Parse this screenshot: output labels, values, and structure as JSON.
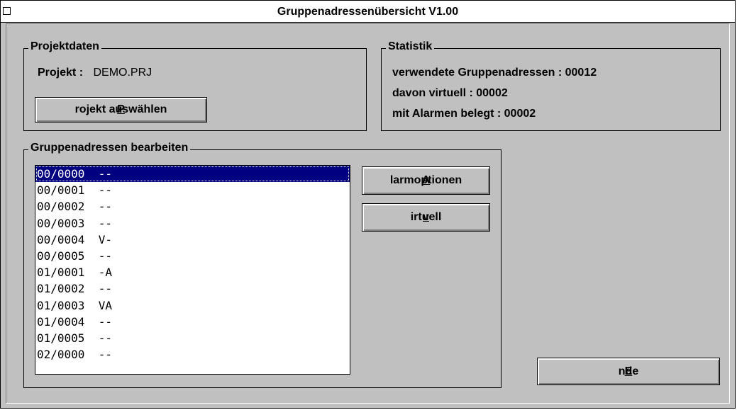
{
  "window": {
    "title": "Gruppenadressenübersicht V1.00"
  },
  "projekt": {
    "group_label": "Projektdaten",
    "projekt_label": "Projekt :",
    "projekt_value": "DEMO.PRJ",
    "button_label_ul": "P",
    "button_label_rest": "rojekt auswählen"
  },
  "statistik": {
    "group_label": "Statistik",
    "line1": "verwendete Gruppenadressen : 00012",
    "line2": "davon virtuell : 00002",
    "line3": "mit Alarmen belegt : 00002"
  },
  "bearbeiten": {
    "group_label": "Gruppenadressen bearbeiten",
    "items": [
      {
        "address": "00/0000",
        "flags": "--"
      },
      {
        "address": "00/0001",
        "flags": "--"
      },
      {
        "address": "00/0002",
        "flags": "--"
      },
      {
        "address": "00/0003",
        "flags": "--"
      },
      {
        "address": "00/0004",
        "flags": "V-"
      },
      {
        "address": "00/0005",
        "flags": "--"
      },
      {
        "address": "01/0001",
        "flags": "-A"
      },
      {
        "address": "01/0002",
        "flags": "--"
      },
      {
        "address": "01/0003",
        "flags": "VA"
      },
      {
        "address": "01/0004",
        "flags": "--"
      },
      {
        "address": "01/0005",
        "flags": "--"
      },
      {
        "address": "02/0000",
        "flags": "--"
      }
    ],
    "selected_index": 0,
    "alarm_ul": "A",
    "alarm_rest": "larmoptionen",
    "virtuell_ul": "v",
    "virtuell_rest": "irtuell"
  },
  "ende": {
    "ul": "E",
    "rest": "nde"
  }
}
